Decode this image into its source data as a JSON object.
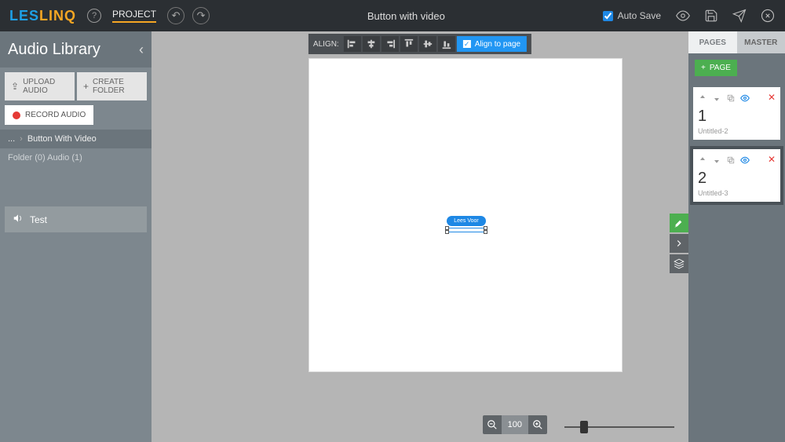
{
  "topbar": {
    "logo_part1": "LES",
    "logo_part2": "LINQ",
    "project_label": "PROJECT",
    "title": "Button with video",
    "autosave_label": "Auto Save",
    "autosave_checked": true
  },
  "left_panel": {
    "title": "Audio Library",
    "upload_label": "UPLOAD AUDIO",
    "create_folder_label": "CREATE FOLDER",
    "record_label": "RECORD AUDIO",
    "breadcrumb_dots": "...",
    "breadcrumb_current": "Button With Video",
    "folder_info": "Folder (0) Audio (1)",
    "audio_item": "Test"
  },
  "align_bar": {
    "label": "ALIGN:",
    "align_to_page": "Align to page"
  },
  "canvas": {
    "button_text": "Lees Voor"
  },
  "zoom": {
    "value": "100"
  },
  "right_panel": {
    "tab_pages": "PAGES",
    "tab_master": "MASTER",
    "add_page": "PAGE",
    "pages": [
      {
        "num": "1",
        "name": "Untitled-2"
      },
      {
        "num": "2",
        "name": "Untitled-3"
      }
    ]
  }
}
